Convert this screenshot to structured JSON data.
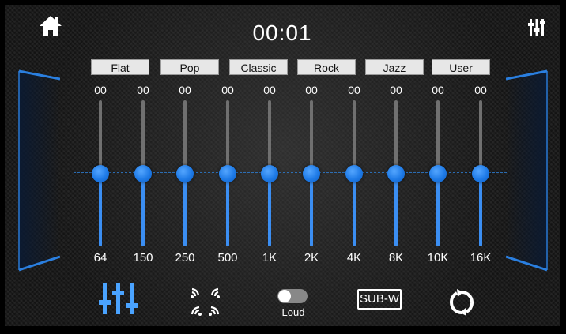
{
  "header": {
    "time": "00:01",
    "home_icon": "home-icon",
    "settings_icon": "equalizer-settings-icon"
  },
  "presets": [
    "Flat",
    "Pop",
    "Classic",
    "Rock",
    "Jazz",
    "User"
  ],
  "bands": [
    {
      "freq": "64",
      "value": "00"
    },
    {
      "freq": "150",
      "value": "00"
    },
    {
      "freq": "250",
      "value": "00"
    },
    {
      "freq": "500",
      "value": "00"
    },
    {
      "freq": "1K",
      "value": "00"
    },
    {
      "freq": "2K",
      "value": "00"
    },
    {
      "freq": "4K",
      "value": "00"
    },
    {
      "freq": "8K",
      "value": "00"
    },
    {
      "freq": "10K",
      "value": "00"
    },
    {
      "freq": "16K",
      "value": "00"
    }
  ],
  "band_level_fraction": 0.5,
  "bottom": {
    "eq_icon": "equalizer-sliders-icon",
    "surround_icon": "sound-field-icon",
    "loud_label": "Loud",
    "loud_on": false,
    "subw_label": "SUB-W",
    "reset_icon": "reset-icon"
  },
  "colors": {
    "accent": "#3b8ef2",
    "knob": "#1e7ae6",
    "panel_edge": "#2a7fe0"
  }
}
